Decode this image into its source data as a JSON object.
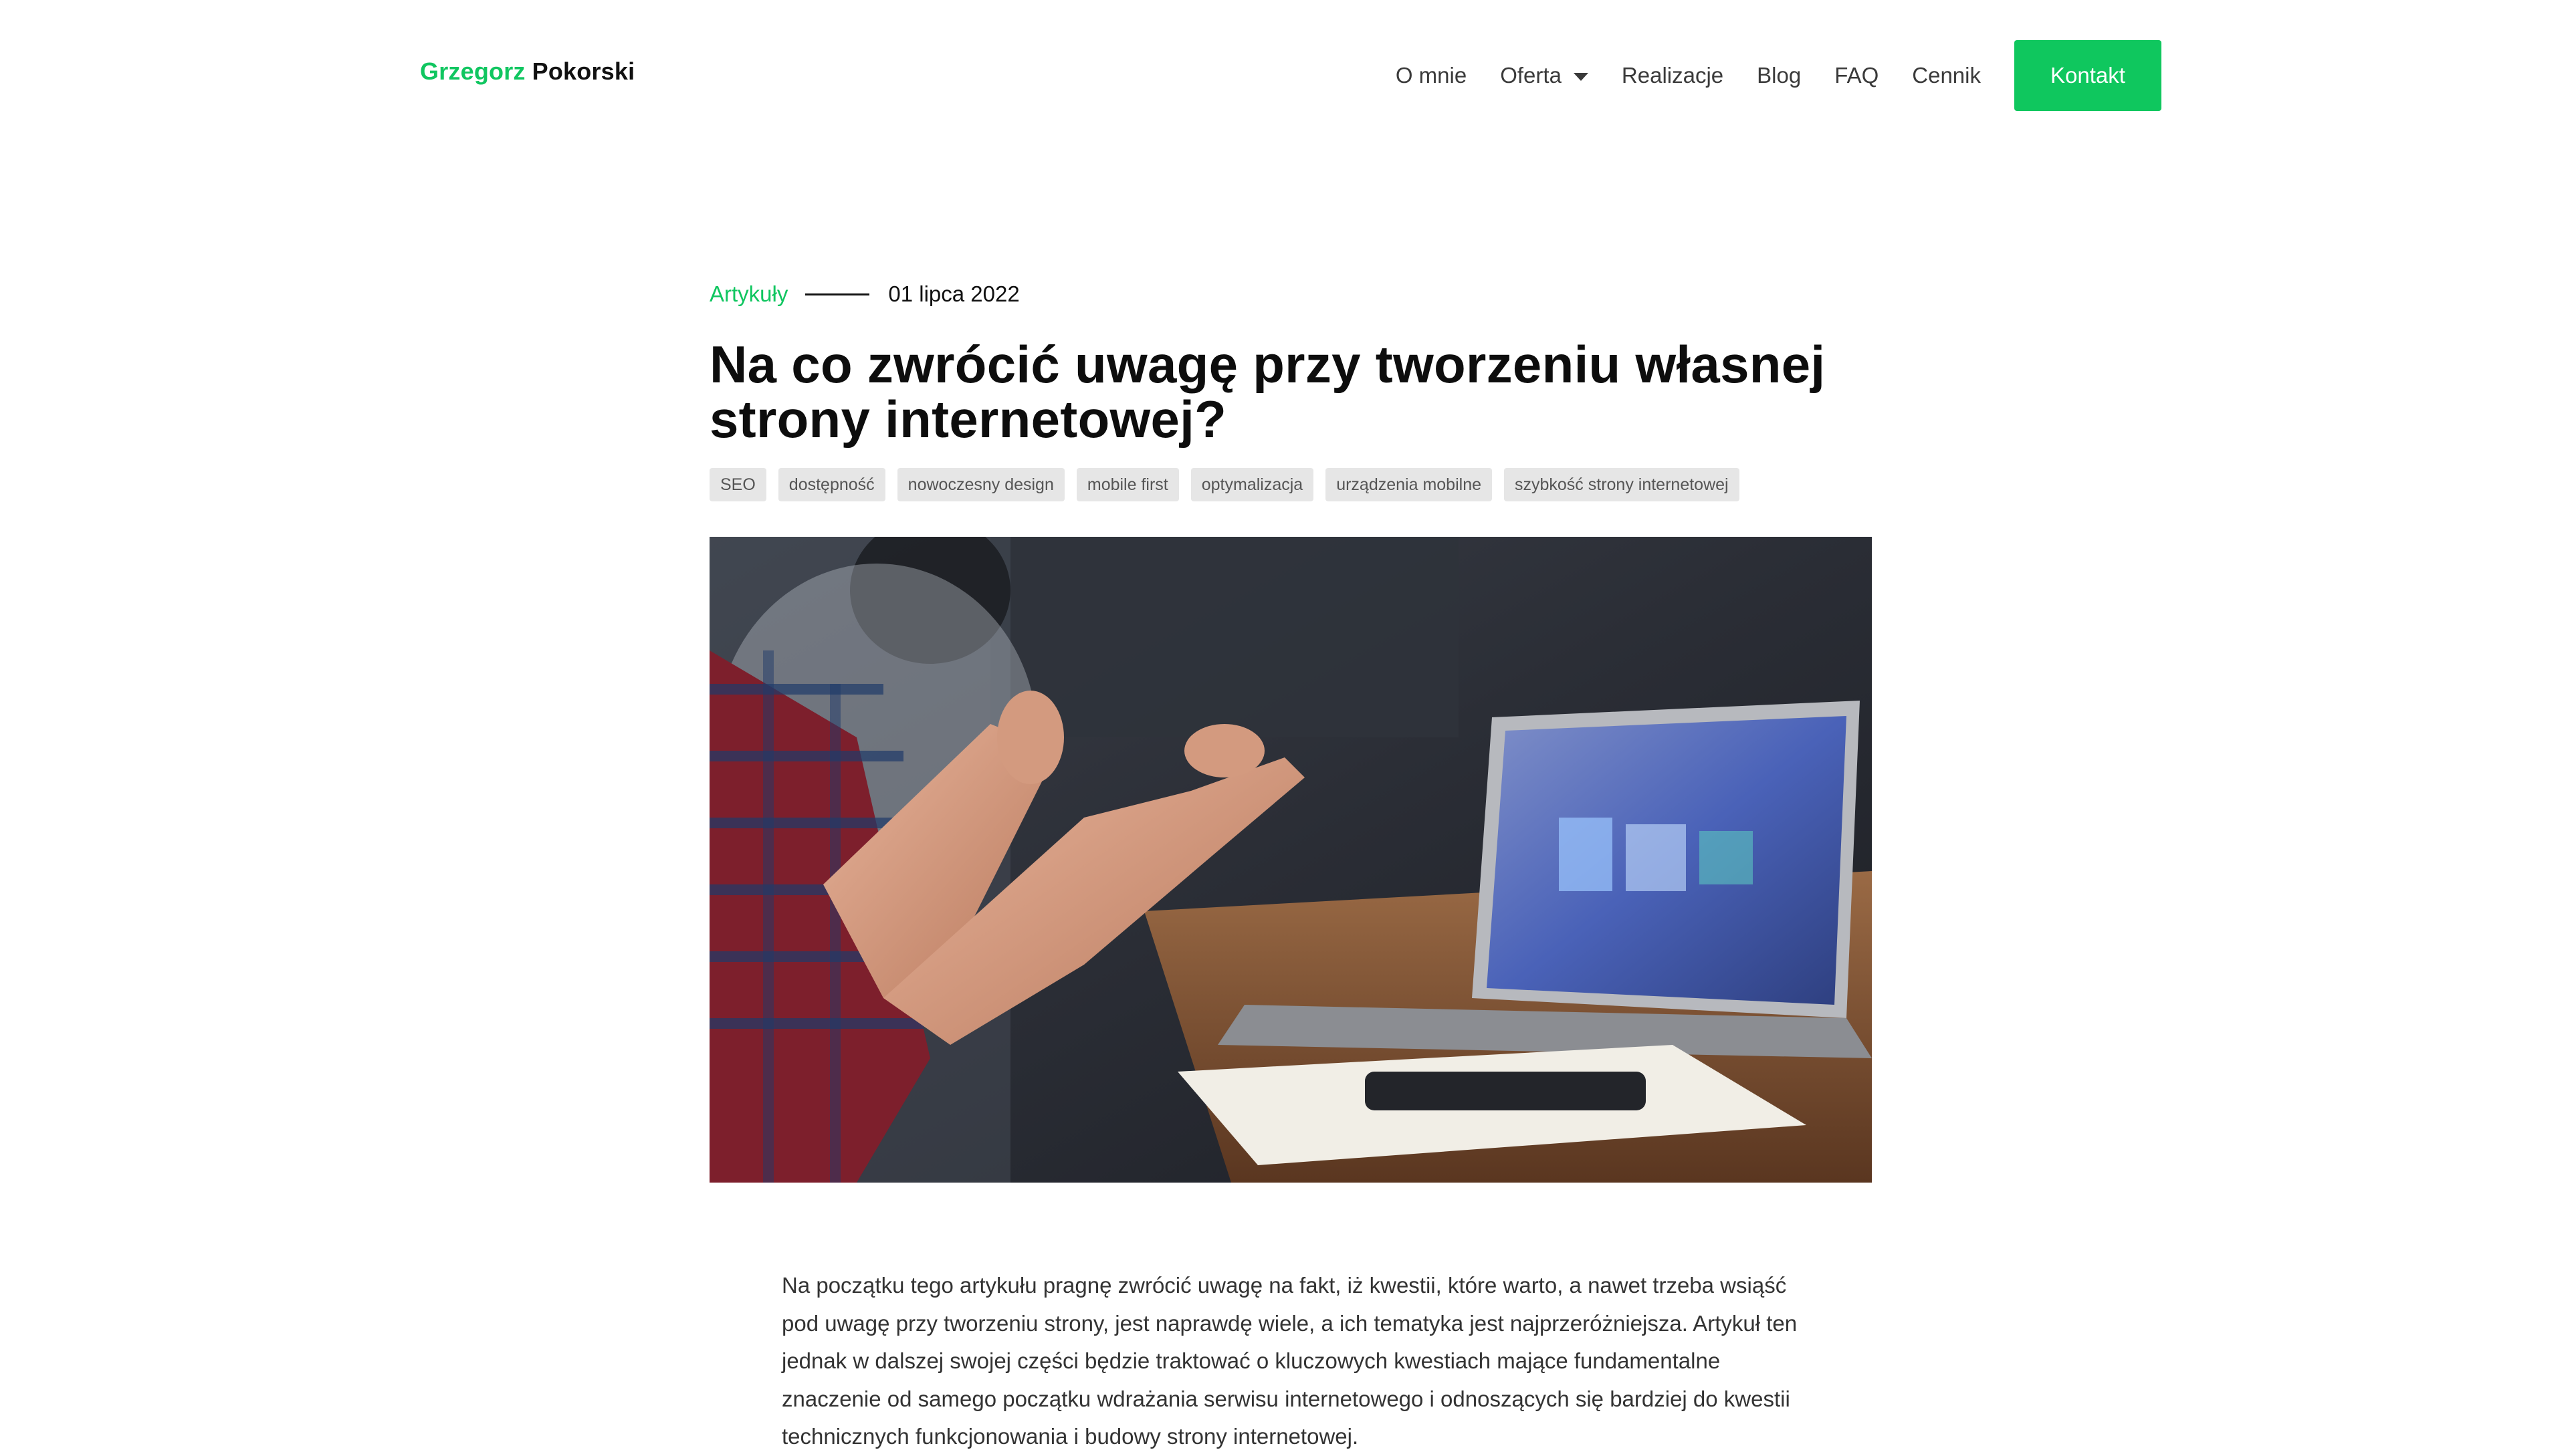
{
  "header": {
    "logo_first": "Grzegorz",
    "logo_last": "Pokorski",
    "nav": [
      {
        "label": "O mnie"
      },
      {
        "label": "Oferta",
        "has_dropdown": true
      },
      {
        "label": "Realizacje"
      },
      {
        "label": "Blog"
      },
      {
        "label": "FAQ"
      },
      {
        "label": "Cennik"
      }
    ],
    "cta_label": "Kontakt"
  },
  "article": {
    "category": "Artykuły",
    "date": "01 lipca 2022",
    "title": "Na co zwrócić uwagę przy tworzeniu własnej strony internetowej?",
    "tags": [
      "SEO",
      "dostępność",
      "nowoczesny design",
      "mobile first",
      "optymalizacja",
      "urządzenia mobilne",
      "szybkość strony internetowej"
    ],
    "intro": "Na początku tego artykułu pragnę zwrócić uwagę na fakt, iż kwestii, które warto, a nawet trzeba wsiąść pod uwagę przy tworzeniu strony, jest naprawdę wiele, a ich tematyka jest najprzeróżniejsza. Artykuł ten jednak w dalszej swojej części będzie traktować o kluczowych kwestiach mające fundamentalne znaczenie od samego początku wdrażania serwisu internetowego i odnoszących się bardziej do kwestii technicznych funkcjonowania i budowy strony internetowej."
  },
  "colors": {
    "accent": "#0fc75e",
    "tag_bg": "#e6e6e6",
    "text": "#333333"
  }
}
